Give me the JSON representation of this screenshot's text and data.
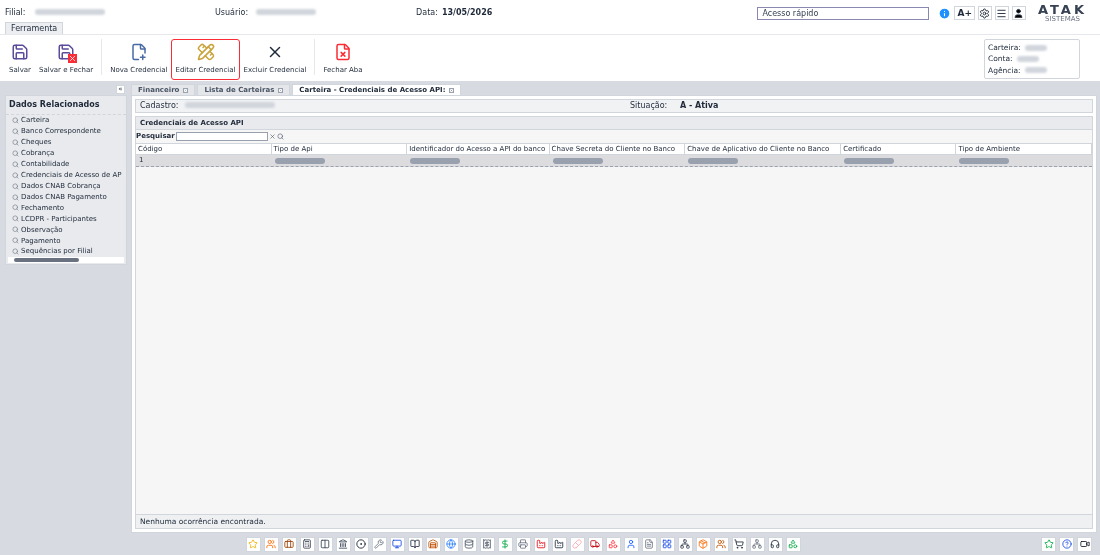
{
  "header": {
    "filial_label": "Filial:",
    "usuario_label": "Usuário:",
    "data_label": "Data:",
    "data_value": "13/05/2026",
    "quick_access": {
      "placeholder": "Acesso rápido"
    },
    "font_button": "A+",
    "logo": {
      "name": "ATAK",
      "tagline": "SISTEMAS"
    }
  },
  "ribbon_tabs": [
    {
      "label": "Ferramenta",
      "selected": true
    }
  ],
  "toolbar": [
    {
      "label": "Salvar",
      "kind": "save",
      "highlighted": false
    },
    {
      "label": "Salvar e Fechar",
      "kind": "save-close",
      "highlighted": false
    },
    {
      "label": "Nova Credencial",
      "kind": "new",
      "highlighted": false
    },
    {
      "label": "Editar Credencial",
      "kind": "edit",
      "highlighted": true
    },
    {
      "label": "Excluir Credencial",
      "kind": "delete",
      "highlighted": false
    },
    {
      "label": "Fechar Aba",
      "kind": "close-tab",
      "highlighted": false
    }
  ],
  "account_box": {
    "fields": [
      {
        "label": "Carteira:"
      },
      {
        "label": "Conta:"
      },
      {
        "label": "Agência:"
      }
    ]
  },
  "sidebar": {
    "collapse_glyph": "«",
    "title": "Dados Relacionados",
    "items": [
      {
        "label": "Carteira"
      },
      {
        "label": "Banco Correspondente"
      },
      {
        "label": "Cheques"
      },
      {
        "label": "Cobrança"
      },
      {
        "label": "Contabilidade"
      },
      {
        "label": "Credenciais de Acesso de AP"
      },
      {
        "label": "Dados CNAB Cobrança"
      },
      {
        "label": "Dados CNAB Pagamento"
      },
      {
        "label": "Fechamento"
      },
      {
        "label": "LCDPR - Participantes"
      },
      {
        "label": "Observação"
      },
      {
        "label": "Pagamento"
      },
      {
        "label": "Sequências por Filial"
      }
    ]
  },
  "tabs": [
    {
      "label": "Financeiro",
      "selected": false
    },
    {
      "label": "Lista de Carteiras",
      "selected": false
    },
    {
      "label": "Carteira - Credenciais de Acesso API:",
      "selected": true
    }
  ],
  "record": {
    "cadastro_label": "Cadastro:",
    "situacao_label": "Situação:",
    "situacao_value": "A - Ativa"
  },
  "section_title": "Credenciais de Acesso API",
  "search": {
    "label": "Pesquisar"
  },
  "table": {
    "columns": [
      "Código",
      "Tipo de Api",
      "Identificador do Acesso a API do banco",
      "Chave Secreta do Cliente no Banco",
      "Chave de Aplicativo do Cliente no Banco",
      "Certificado",
      "Tipo de Ambiente"
    ],
    "rows": [
      {
        "cells": [
          "1"
        ],
        "selected": true
      }
    ]
  },
  "status": "Nenhuma ocorrência encontrada."
}
